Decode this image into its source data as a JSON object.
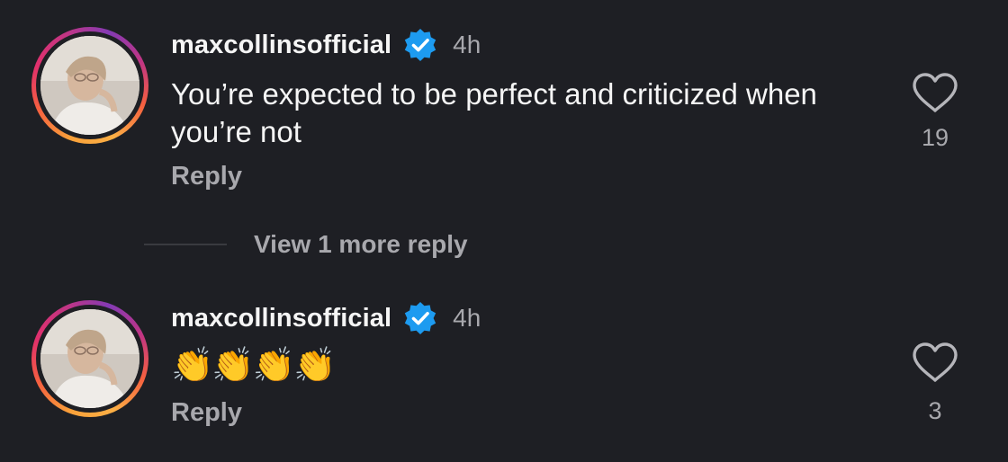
{
  "colors": {
    "background": "#1e1f24",
    "primary_text": "#f5f5f5",
    "secondary_text": "#a8a8ad",
    "verified_badge": "#1d9bf0"
  },
  "comments": [
    {
      "username": "maxcollinsofficial",
      "verified": true,
      "verified_icon": "verified-badge-icon",
      "timestamp": "4h",
      "text": "You’re expected to be perfect and criticized when you’re not",
      "reply_label": "Reply",
      "like_icon": "heart-outline-icon",
      "like_count": "19"
    },
    {
      "username": "maxcollinsofficial",
      "verified": true,
      "verified_icon": "verified-badge-icon",
      "timestamp": "4h",
      "text": "👏👏👏👏",
      "reply_label": "Reply",
      "like_icon": "heart-outline-icon",
      "like_count": "3"
    }
  ],
  "view_more_replies": "View 1 more reply"
}
